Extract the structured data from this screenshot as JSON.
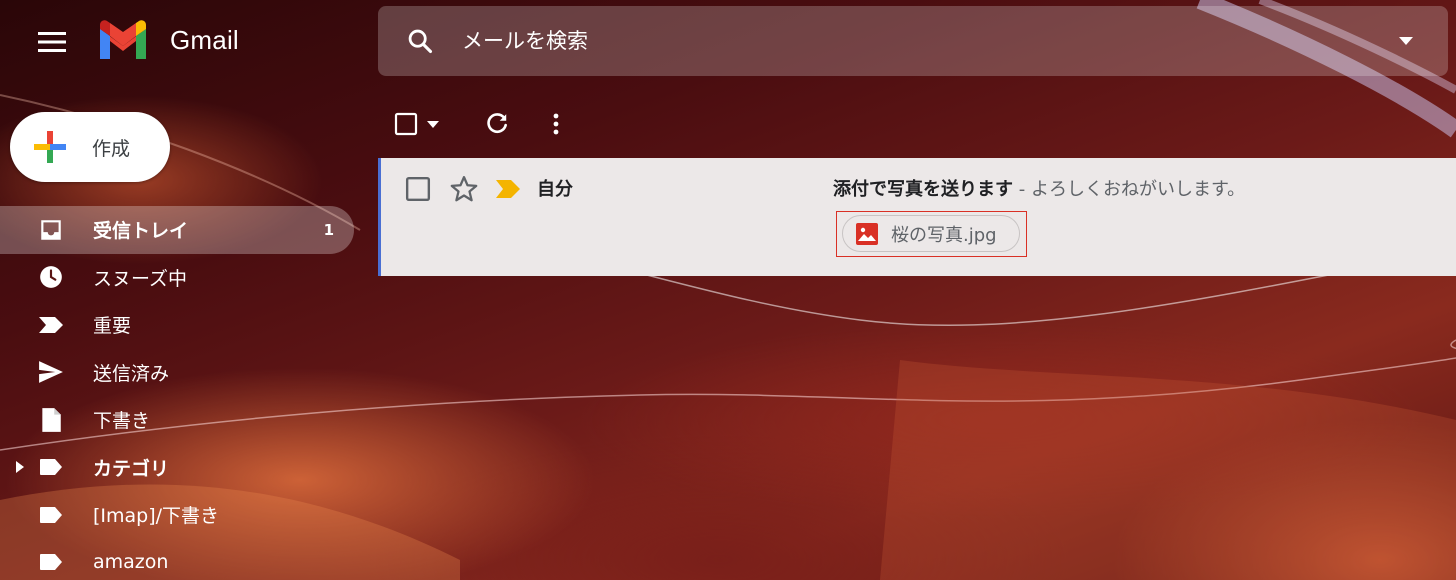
{
  "app": {
    "name": "Gmail"
  },
  "search": {
    "placeholder": "メールを検索"
  },
  "compose": {
    "label": "作成"
  },
  "sidebar": {
    "items": [
      {
        "label": "受信トレイ",
        "count": "1",
        "icon": "inbox-icon",
        "active": true,
        "bold": true
      },
      {
        "label": "スヌーズ中",
        "icon": "clock-icon"
      },
      {
        "label": "重要",
        "icon": "important-label-icon"
      },
      {
        "label": "送信済み",
        "icon": "send-icon"
      },
      {
        "label": "下書き",
        "icon": "draft-file-icon"
      },
      {
        "label": "カテゴリ",
        "icon": "label-icon",
        "bold": true,
        "expandable": true
      },
      {
        "label": "[Imap]/下書き",
        "icon": "label-icon"
      },
      {
        "label": "amazon",
        "icon": "label-icon"
      }
    ]
  },
  "toolbar": {
    "actions": [
      "select-all-checkbox",
      "select-menu",
      "refresh",
      "more-options"
    ]
  },
  "messages": [
    {
      "sender": "自分",
      "subject": "添付で写真を送ります",
      "separator": " - ",
      "snippet": "よろしくおねがいします。",
      "attachment": {
        "name": "桜の写真.jpg",
        "icon": "image-file-icon"
      }
    }
  ],
  "colors": {
    "accent_blue": "#4a6fd3",
    "important_yellow": "#f4b400",
    "attachment_red": "#d93025",
    "highlight_box": "#d93025"
  }
}
